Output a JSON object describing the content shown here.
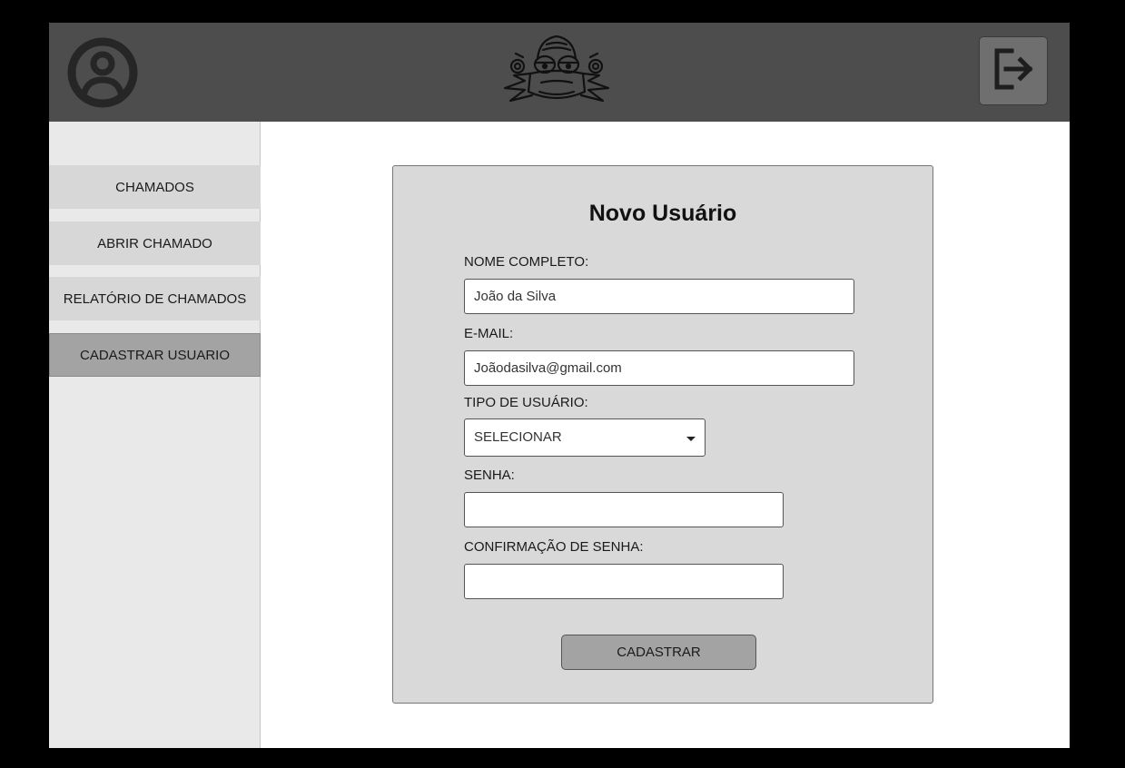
{
  "header": {
    "avatar_icon": "user-circle-icon",
    "logo_icon": "gorilla-logo-icon",
    "logout_icon": "logout-icon",
    "colors": {
      "bar": "#4d4d4d",
      "logout_button": "#6f6f6f"
    }
  },
  "sidebar": {
    "items": [
      {
        "label": "CHAMADOS",
        "active": false
      },
      {
        "label": "ABRIR CHAMADO",
        "active": false
      },
      {
        "label": "RELATÓRIO DE CHAMADOS",
        "active": false
      },
      {
        "label": "CADASTRAR USUARIO",
        "active": true
      }
    ]
  },
  "form": {
    "title": "Novo Usuário",
    "name": {
      "label": "NOME COMPLETO:",
      "value": "João da Silva"
    },
    "email": {
      "label": "E-MAIL:",
      "value": "Joãodasilva@gmail.com"
    },
    "user_type": {
      "label": "TIPO DE USUÁRIO:",
      "selected": "SELECIONAR"
    },
    "password": {
      "label": "SENHA:",
      "value": ""
    },
    "password_confirm": {
      "label": "CONFIRMAÇÃO DE SENHA:",
      "value": ""
    },
    "submit_label": "CADASTRAR"
  }
}
